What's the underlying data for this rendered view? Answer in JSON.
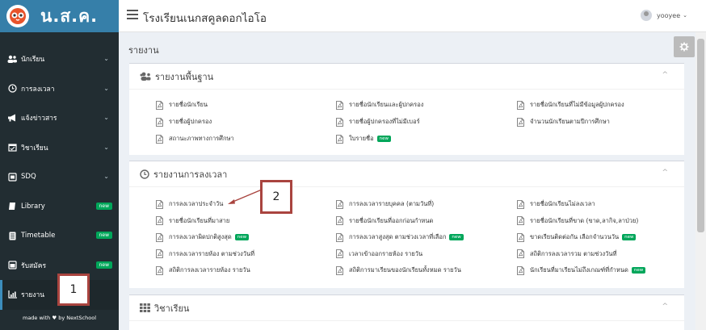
{
  "brand": {
    "logo_text": "น.ส.ค."
  },
  "header": {
    "school_name": "โรงเรียนเนกสคูลดอกไอโอ",
    "username": "yooyee"
  },
  "sidebar": {
    "items": [
      {
        "label": "นักเรียน",
        "icon": "users-icon",
        "badge": ""
      },
      {
        "label": "การลงเวลา",
        "icon": "clock-icon",
        "badge": ""
      },
      {
        "label": "แจ้งข่าวสาร",
        "icon": "bullhorn-icon",
        "badge": ""
      },
      {
        "label": "วิชาเรียน",
        "icon": "calendar-icon",
        "badge": ""
      },
      {
        "label": "SDQ",
        "icon": "form-icon",
        "badge": ""
      },
      {
        "label": "Library",
        "icon": "book-icon",
        "badge": "new"
      },
      {
        "label": "Timetable",
        "icon": "timetable-icon",
        "badge": "new"
      },
      {
        "label": "รับสมัคร",
        "icon": "inbox-icon",
        "badge": "new"
      },
      {
        "label": "รายงาน",
        "icon": "bar-chart-icon",
        "badge": ""
      }
    ],
    "made_by": "made with ♥ by NextSchool"
  },
  "main": {
    "page_title": "รายงาน",
    "sections": [
      {
        "title": "รายงานพื้นฐาน",
        "icon": "users-icon",
        "items": [
          {
            "label": "รายชื่อนักเรียน",
            "badge": ""
          },
          {
            "label": "รายชื่อนักเรียนและผู้ปกครอง",
            "badge": ""
          },
          {
            "label": "รายชื่อนักเรียนที่ไม่มีข้อมูลผู้ปกครอง",
            "badge": ""
          },
          {
            "label": "รายชื่อผู้ปกครอง",
            "badge": ""
          },
          {
            "label": "รายชื่อผู้ปกครองที่ไม่มีเบอร์",
            "badge": ""
          },
          {
            "label": "จำนวนนักเรียนตามปีการศึกษา",
            "badge": ""
          },
          {
            "label": "สถานะภาพทางการศึกษา",
            "badge": ""
          },
          {
            "label": "ใบรายชื่อ",
            "badge": "new"
          }
        ]
      },
      {
        "title": "รายงานการลงเวลา",
        "icon": "clock-icon",
        "items": [
          {
            "label": "การลงเวลาประจำวัน",
            "badge": ""
          },
          {
            "label": "การลงเวลารายบุคคล (ตามวันที่)",
            "badge": ""
          },
          {
            "label": "รายชื่อนักเรียนไม่ลงเวลา",
            "badge": ""
          },
          {
            "label": "รายชื่อนักเรียนที่มาสาย",
            "badge": ""
          },
          {
            "label": "รายชื่อนักเรียนที่ออกก่อนกำหนด",
            "badge": ""
          },
          {
            "label": "รายชื่อนักเรียนที่ขาด (ขาด,ลากิจ,ลาป่วย)",
            "badge": ""
          },
          {
            "label": "การลงเวลาผิดปกติสูงสุด",
            "badge": "new"
          },
          {
            "label": "การลงเวลาสูงสุด ตามช่วงเวลาที่เลือก",
            "badge": "new"
          },
          {
            "label": "ขาดเรียนติดต่อกัน เลือกจำนวนวัน",
            "badge": "new"
          },
          {
            "label": "การลงเวลารายห้อง ตามช่วงวันที่",
            "badge": ""
          },
          {
            "label": "เวลาเข้าออกรายห้อง รายวัน",
            "badge": ""
          },
          {
            "label": "สถิติการลงเวลารวม ตามช่วงวันที่",
            "badge": ""
          },
          {
            "label": "สถิติการลงเวลารายห้อง รายวัน",
            "badge": ""
          },
          {
            "label": "สถิติการมาเรียนของนักเรียนทั้งหมด รายวัน",
            "badge": ""
          },
          {
            "label": "นักเรียนที่มาเรียนไม่ถึงเกณฑ์ที่กำหนด",
            "badge": "new"
          }
        ]
      },
      {
        "title": "วิชาเรียน",
        "icon": "grid-icon",
        "items": []
      }
    ]
  },
  "annotations": {
    "callout_1": "1",
    "callout_2": "2"
  }
}
